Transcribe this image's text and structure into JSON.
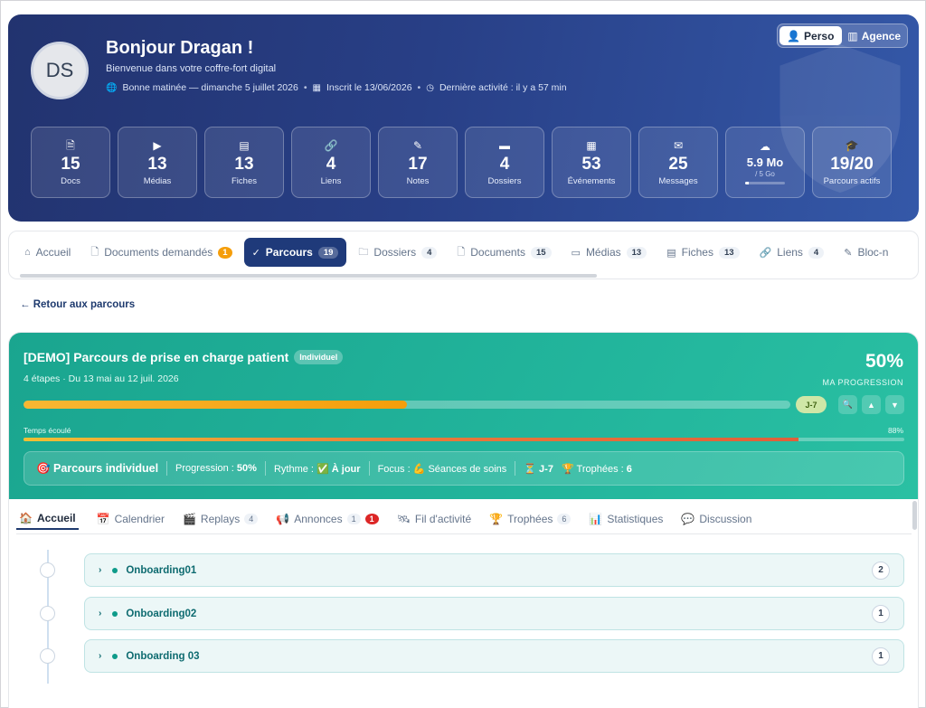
{
  "header": {
    "avatar_initials": "DS",
    "greeting": "Bonjour Dragan !",
    "subtitle": "Bienvenue dans votre coffre-fort digital",
    "meta": {
      "time_of_day": "Bonne matinée — dimanche 5 juillet 2026",
      "registered": "Inscrit le 13/06/2026",
      "last_activity": "Dernière activité : il y a 57 min"
    },
    "toggle": {
      "perso": "Perso",
      "agence": "Agence",
      "active": "perso"
    },
    "stats": [
      {
        "icon": "document-icon",
        "glyph": "🗎",
        "value": "15",
        "label": "Docs"
      },
      {
        "icon": "media-icon",
        "glyph": "▶",
        "value": "13",
        "label": "Médias"
      },
      {
        "icon": "fiches-icon",
        "glyph": "▤",
        "value": "13",
        "label": "Fiches"
      },
      {
        "icon": "link-icon",
        "glyph": "🔗",
        "value": "4",
        "label": "Liens"
      },
      {
        "icon": "note-icon",
        "glyph": "✎",
        "value": "17",
        "label": "Notes"
      },
      {
        "icon": "folder-icon",
        "glyph": "▬",
        "value": "4",
        "label": "Dossiers"
      },
      {
        "icon": "calendar-icon",
        "glyph": "▦",
        "value": "53",
        "label": "Événements"
      },
      {
        "icon": "mail-icon",
        "glyph": "✉",
        "value": "25",
        "label": "Messages"
      },
      {
        "icon": "cloud-icon",
        "glyph": "☁",
        "value": "5.9 Mo",
        "label": "",
        "quota": "/ 5 Go",
        "quota_fill": 0.1
      },
      {
        "icon": "graduation-cap-icon",
        "glyph": "🎓",
        "value": "19/20",
        "label": "Parcours actifs"
      }
    ]
  },
  "tabs": [
    {
      "id": "accueil",
      "icon": "home-icon",
      "glyph": "⌂",
      "label": "Accueil",
      "count": ""
    },
    {
      "id": "documents-demandes",
      "icon": "document-icon",
      "glyph": "🗋",
      "label": "Documents demandés",
      "count": "1",
      "orange": true
    },
    {
      "id": "parcours",
      "icon": "check-circle-icon",
      "glyph": "✓",
      "label": "Parcours",
      "count": "19",
      "active": true
    },
    {
      "id": "dossiers",
      "icon": "folder-icon",
      "glyph": "🗀",
      "label": "Dossiers",
      "count": "4"
    },
    {
      "id": "documents",
      "icon": "document-icon",
      "glyph": "🗋",
      "label": "Documents",
      "count": "15"
    },
    {
      "id": "medias",
      "icon": "video-icon",
      "glyph": "▭",
      "label": "Médias",
      "count": "13"
    },
    {
      "id": "fiches",
      "icon": "fiches-icon",
      "glyph": "▤",
      "label": "Fiches",
      "count": "13"
    },
    {
      "id": "liens",
      "icon": "link-icon",
      "glyph": "🔗",
      "label": "Liens",
      "count": "4"
    },
    {
      "id": "bloc-notes",
      "icon": "edit-icon",
      "glyph": "✎",
      "label": "Bloc-n",
      "count": ""
    }
  ],
  "back_link": "← Retour aux parcours",
  "parcours": {
    "title": "[DEMO] Parcours de prise en charge patient",
    "badge": "Individuel",
    "subtitle": "4 étapes · Du 13 mai au 12 juil. 2026",
    "progress_pct": "50%",
    "progress_label": "MA PROGRESSION",
    "progress_value": 0.5,
    "days_badge": "J-7",
    "elapsed_label": "Temps écoulé",
    "elapsed_pct": "88%",
    "elapsed_value": 0.88,
    "info": {
      "type": "🎯 Parcours individuel",
      "progression_label": "Progression :",
      "progression_value": "50%",
      "rythme_label": "Rythme :",
      "rythme_value": "✅ À jour",
      "focus_label": "Focus :",
      "focus_value": "💪 Séances de soins",
      "countdown": "⏳ J-7",
      "trophies_label": "🏆 Trophées :",
      "trophies_value": "6"
    }
  },
  "subtabs": [
    {
      "id": "accueil",
      "glyph": "🏠",
      "label": "Accueil",
      "active": true
    },
    {
      "id": "calendrier",
      "glyph": "📅",
      "label": "Calendrier"
    },
    {
      "id": "replays",
      "glyph": "🎬",
      "label": "Replays",
      "count": "4"
    },
    {
      "id": "annonces",
      "glyph": "📢",
      "label": "Annonces",
      "count": "1",
      "red": "1"
    },
    {
      "id": "fil",
      "glyph": "🛰",
      "label": "Fil d'activité"
    },
    {
      "id": "trophees",
      "glyph": "🏆",
      "label": "Trophées",
      "count": "6"
    },
    {
      "id": "statistiques",
      "glyph": "📊",
      "label": "Statistiques"
    },
    {
      "id": "discussion",
      "glyph": "💬",
      "label": "Discussion"
    }
  ],
  "steps": [
    {
      "label": "Onboarding01",
      "count": "2"
    },
    {
      "label": "Onboarding02",
      "count": "1"
    },
    {
      "label": "Onboarding 03",
      "count": "1"
    }
  ]
}
